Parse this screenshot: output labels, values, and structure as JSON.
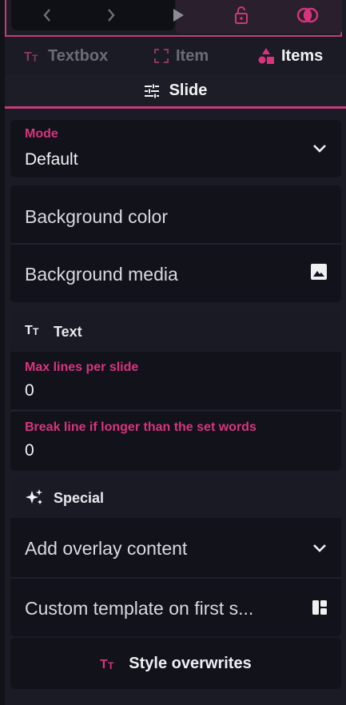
{
  "tabs": [
    {
      "label": "Textbox",
      "icon": "text-format-icon",
      "active": false
    },
    {
      "label": "Item",
      "icon": "fullscreen-frame-icon",
      "active": false
    },
    {
      "label": "Items",
      "icon": "shapes-icon",
      "active": true
    }
  ],
  "slide_tab": {
    "label": "Slide",
    "icon": "tune-sliders-icon"
  },
  "mode": {
    "label": "Mode",
    "value": "Default",
    "icon": "chevron-down-icon"
  },
  "background_color": {
    "label": "Background color"
  },
  "background_media": {
    "label": "Background media",
    "icon": "image-icon"
  },
  "text_section": {
    "title": "Text",
    "max_lines": {
      "label": "Max lines per slide",
      "value": "0"
    },
    "break_line": {
      "label": "Break line if longer than the set words",
      "value": "0"
    }
  },
  "special_section": {
    "title": "Special",
    "overlay": {
      "label": "Add overlay content",
      "icon": "chevron-down-icon"
    },
    "custom_template": {
      "label": "Custom template on first s...",
      "icon": "dashboard-layout-icon"
    }
  },
  "style_overwrites": {
    "label": "Style overwrites",
    "icon": "text-format-icon"
  },
  "colors": {
    "accent": "#d8347e",
    "panel": "#11121a",
    "background": "#1a1b24"
  }
}
